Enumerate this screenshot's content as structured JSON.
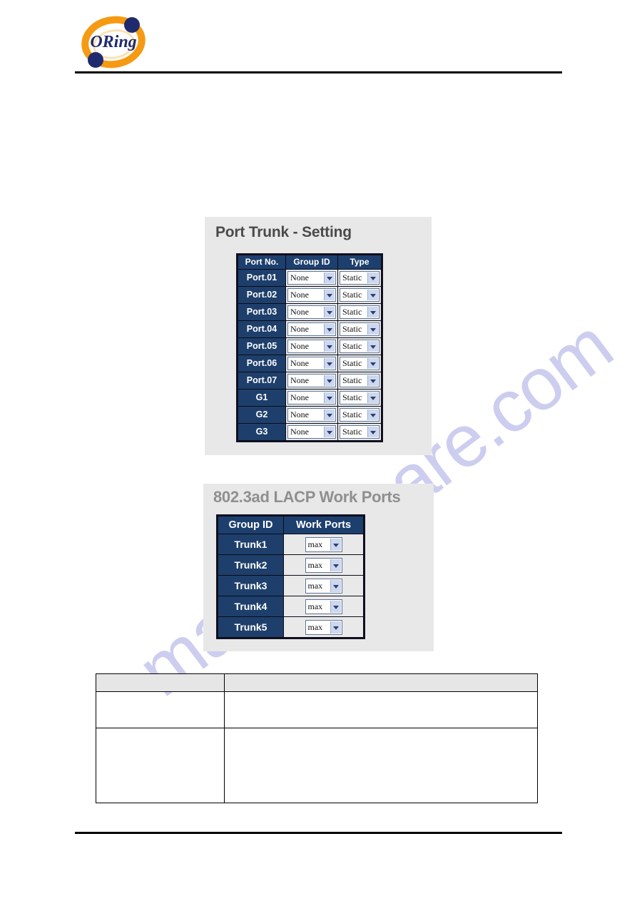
{
  "document": {
    "brand": "ORing",
    "watermark_text": "manualshare.com"
  },
  "port_trunk_panel": {
    "title": "Port Trunk - Setting",
    "columns": [
      "Port No.",
      "Group ID",
      "Type"
    ],
    "rows": [
      {
        "port": "Port.01",
        "group_id": "None",
        "type": "Static"
      },
      {
        "port": "Port.02",
        "group_id": "None",
        "type": "Static"
      },
      {
        "port": "Port.03",
        "group_id": "None",
        "type": "Static"
      },
      {
        "port": "Port.04",
        "group_id": "None",
        "type": "Static"
      },
      {
        "port": "Port.05",
        "group_id": "None",
        "type": "Static"
      },
      {
        "port": "Port.06",
        "group_id": "None",
        "type": "Static"
      },
      {
        "port": "Port.07",
        "group_id": "None",
        "type": "Static"
      },
      {
        "port": "G1",
        "group_id": "None",
        "type": "Static"
      },
      {
        "port": "G2",
        "group_id": "None",
        "type": "Static"
      },
      {
        "port": "G3",
        "group_id": "None",
        "type": "Static"
      }
    ]
  },
  "lacp_panel": {
    "title": "802.3ad LACP Work Ports",
    "columns": [
      "Group ID",
      "Work Ports"
    ],
    "rows": [
      {
        "group_id": "Trunk1",
        "work_ports": "max"
      },
      {
        "group_id": "Trunk2",
        "work_ports": "max"
      },
      {
        "group_id": "Trunk3",
        "work_ports": "max"
      },
      {
        "group_id": "Trunk4",
        "work_ports": "max"
      },
      {
        "group_id": "Trunk5",
        "work_ports": "max"
      }
    ]
  },
  "description_table": {
    "header": [
      "",
      ""
    ],
    "rows": [
      {
        "label": "",
        "description": ""
      },
      {
        "label": "",
        "description": ""
      }
    ]
  },
  "colors": {
    "header_blue": "#1d3f6e",
    "row_head_blue": "#1e3f6b",
    "panel_gray": "#e8e8e8",
    "logo_orange": "#f59a13",
    "logo_navy": "#1f2a6e",
    "watermark": "#cdcdf0"
  }
}
